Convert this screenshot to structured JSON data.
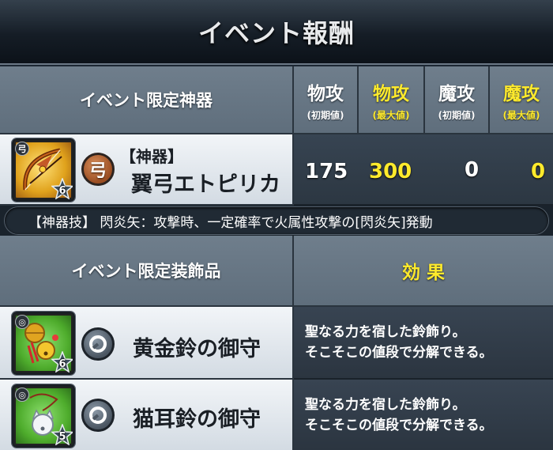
{
  "title": "イベント報酬",
  "weapon_section": {
    "header": "イベント限定神器",
    "stat_headers": [
      {
        "label": "物攻",
        "sub": "(初期値)",
        "highlight": false
      },
      {
        "label": "物攻",
        "sub": "(最大値)",
        "highlight": true
      },
      {
        "label": "魔攻",
        "sub": "(初期値)",
        "highlight": false
      },
      {
        "label": "魔攻",
        "sub": "(最大値)",
        "highlight": true
      }
    ],
    "item": {
      "category": "【神器】",
      "name": "翼弓エトピリカ",
      "type_badge": "弓",
      "corner_tag": "弓",
      "rarity": "6",
      "icon": "bow-weapon-icon",
      "stats": [
        "175",
        "300",
        "0",
        "0"
      ]
    },
    "skill": "【神器技】 閃炎矢：攻撃時、一定確率で火属性攻撃の[閃炎矢]発動"
  },
  "accessory_section": {
    "header": "イベント限定装飾品",
    "effect_header": "効 果",
    "items": [
      {
        "name": "黄金鈴の御守",
        "rarity": "6",
        "icon": "golden-bell-charm-icon",
        "effect_line1": "聖なる力を宿した鈴飾り。",
        "effect_line2": "そこそこの値段で分解できる。"
      },
      {
        "name": "猫耳鈴の御守",
        "rarity": "5",
        "icon": "cat-ear-bell-charm-icon",
        "effect_line1": "聖なる力を宿した鈴飾り。",
        "effect_line2": "そこそこの値段で分解できる。"
      }
    ]
  },
  "colors": {
    "highlight_gold": "#ffea2c",
    "header_bg": "#6b7a88",
    "dark_bg": "#2f3a46",
    "light_row": "#e6ebf0",
    "icon_weapon_bg": "#e0a21c",
    "icon_accessory_bg": "#4eac2c"
  }
}
